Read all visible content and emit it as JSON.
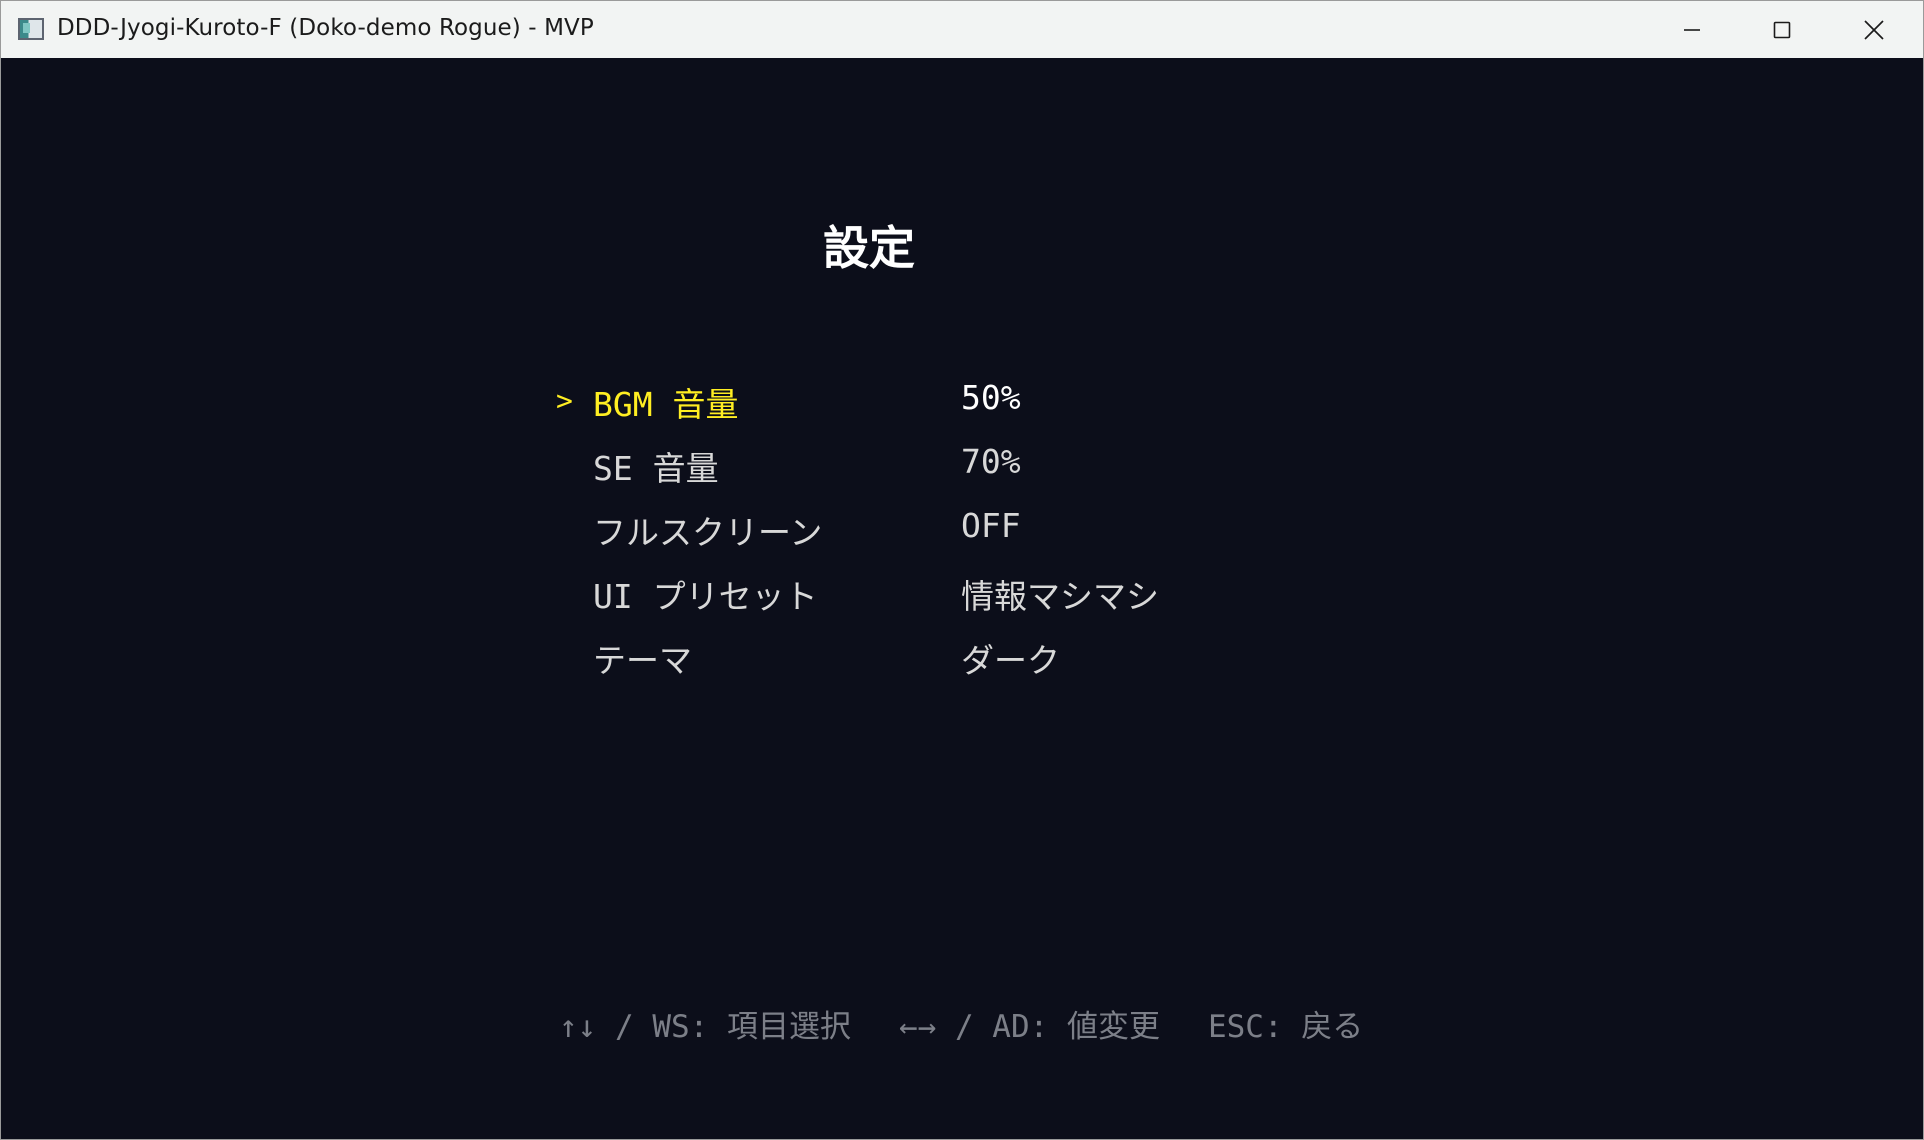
{
  "window": {
    "title": "DDD-Jyogi-Kuroto-F (Doko-demo Rogue) - MVP",
    "controls": {
      "minimize_icon": "minimize-icon",
      "maximize_icon": "maximize-icon",
      "close_icon": "close-icon"
    }
  },
  "screen": {
    "title": "設定"
  },
  "settings": {
    "cursor": ">",
    "selected_index": 0,
    "items": [
      {
        "label": "BGM 音量",
        "value": "50%"
      },
      {
        "label": "SE 音量",
        "value": "70%"
      },
      {
        "label": "フルスクリーン",
        "value": "OFF"
      },
      {
        "label": "UI プリセット",
        "value": "情報マシマシ"
      },
      {
        "label": "テーマ",
        "value": "ダーク"
      }
    ]
  },
  "help": {
    "navigate": "↑↓ / WS: 項目選択",
    "change": "←→ / AD: 値変更",
    "back": "ESC: 戻る"
  },
  "colors": {
    "background": "#0c0e1a",
    "selected": "#ffee22",
    "text": "#d8d8d8",
    "help": "#7c7f88"
  }
}
